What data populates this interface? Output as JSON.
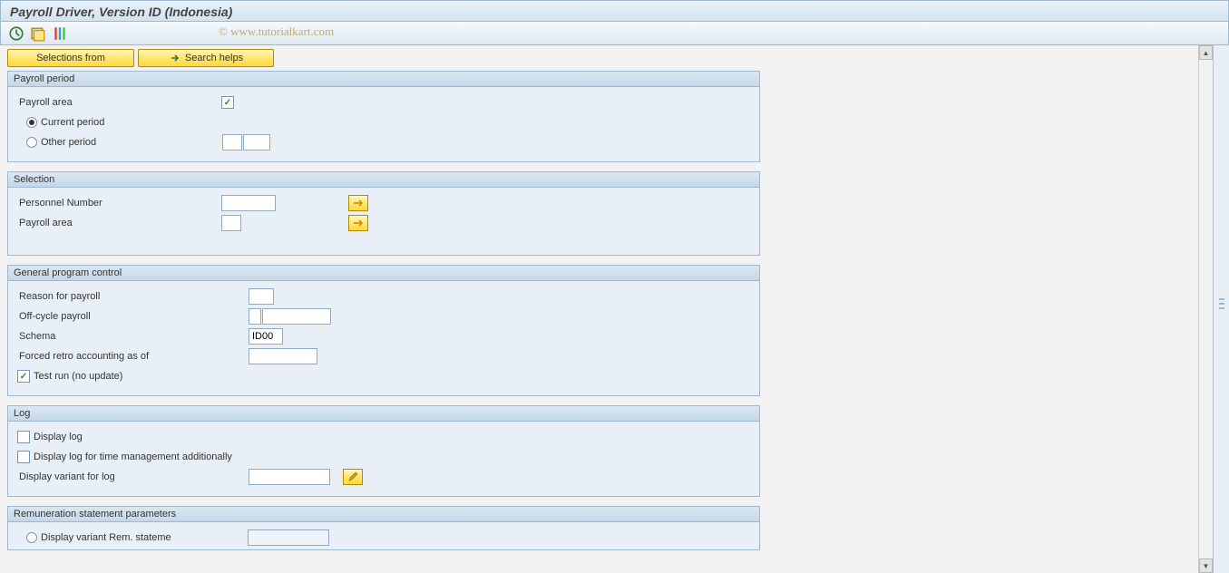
{
  "window": {
    "title": "Payroll Driver, Version ID (Indonesia)"
  },
  "watermark": "© www.tutorialkart.com",
  "topButtons": {
    "selectionsFrom": "Selections from",
    "searchHelps": "Search helps"
  },
  "groups": {
    "payrollPeriod": {
      "title": "Payroll period",
      "payrollAreaLabel": "Payroll area",
      "payrollAreaChk": true,
      "currentPeriod": "Current period",
      "otherPeriod": "Other period",
      "periodSel": "current",
      "otherVal1": "",
      "otherVal2": ""
    },
    "selection": {
      "title": "Selection",
      "personnelNumberLabel": "Personnel Number",
      "personnelNumberVal": "",
      "payrollAreaLabel": "Payroll area",
      "payrollAreaVal": ""
    },
    "general": {
      "title": "General program control",
      "reasonLabel": "Reason for payroll",
      "reasonVal": "",
      "offCycleLabel": "Off-cycle payroll",
      "offCycleVal1": "",
      "offCycleVal2": "",
      "schemaLabel": "Schema",
      "schemaVal": "ID00",
      "forcedRetroLabel": "Forced retro accounting as of",
      "forcedRetroVal": "",
      "testRunLabel": "Test run (no update)",
      "testRunChk": true
    },
    "log": {
      "title": "Log",
      "displayLogLabel": "Display log",
      "displayLogChk": false,
      "displayLogTimeLabel": "Display log for time management additionally",
      "displayLogTimeChk": false,
      "displayVariantLabel": "Display variant for log",
      "displayVariantVal": ""
    },
    "remuneration": {
      "title": "Remuneration statement parameters",
      "displayVariantRemLabel": "Display variant Rem. stateme",
      "displayVariantRemSel": false
    }
  }
}
